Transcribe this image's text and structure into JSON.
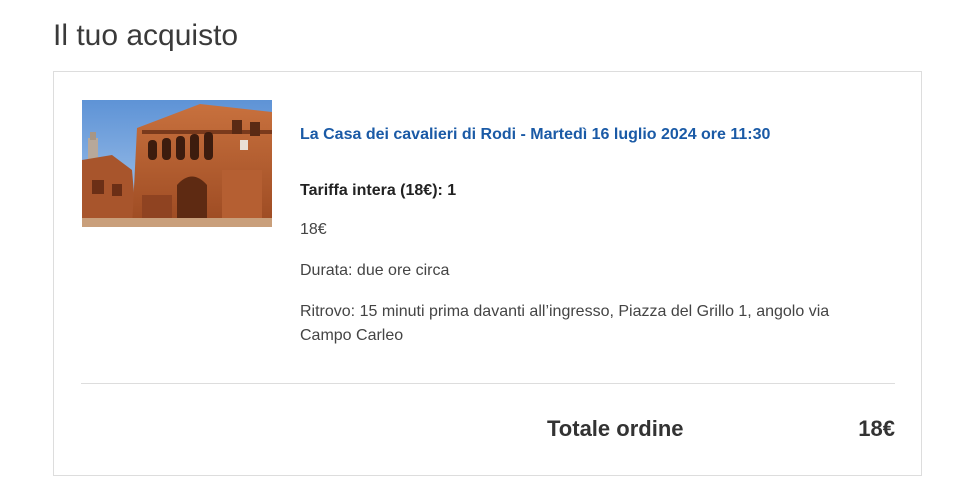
{
  "page": {
    "title": "Il tuo acquisto"
  },
  "order": {
    "item_title": "La Casa dei cavalieri di Rodi - Martedì 16 luglio 2024 ore 11:30",
    "fare": "Tariffa intera (18€): 1",
    "price": "18€",
    "duration": "Durata: due ore circa",
    "meeting_point": "Ritrovo: 15 minuti prima davanti all’ingresso, Piazza del Grillo 1, angolo via Campo Carleo",
    "image_icon": "building-photo"
  },
  "total": {
    "label": "Totale ordine",
    "value": "18€"
  },
  "colors": {
    "link": "#1a5aa6",
    "border": "#dddddd"
  }
}
